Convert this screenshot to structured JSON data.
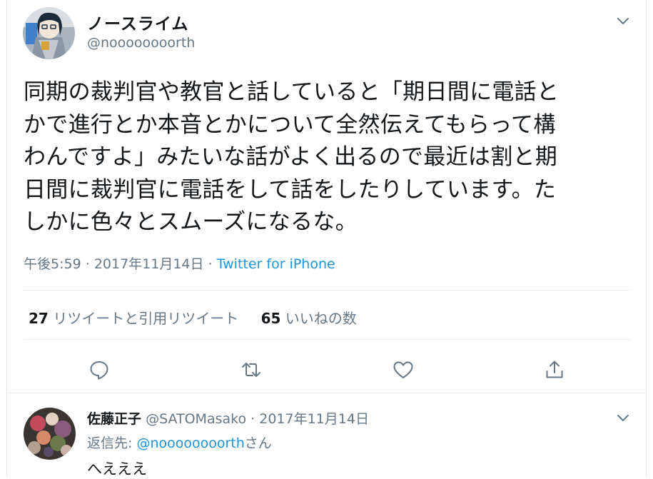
{
  "tweet": {
    "author": {
      "name": "ノースライム",
      "handle": "@noooooooorth"
    },
    "text": "同期の裁判官や教官と話していると「期日間に電話と\nかで進行とか本音とかについて全然伝えてもらって構\nわんですよ」みたいな話がよく出るので最近は割と期\n日間に裁判官に電話をして話をしたりしています。た\nしかに色々とスムーズになるな。",
    "time": "午後5:59",
    "date": "2017年11月14日",
    "separator": "·",
    "source": "Twitter for iPhone",
    "stats": {
      "retweets_count": "27",
      "retweets_label": "リツイートと引用リツイート",
      "likes_count": "65",
      "likes_label": "いいねの数"
    }
  },
  "actions": [
    {
      "name": "reply",
      "icon": "reply-icon"
    },
    {
      "name": "retweet",
      "icon": "retweet-icon"
    },
    {
      "name": "like",
      "icon": "heart-icon"
    },
    {
      "name": "share",
      "icon": "share-icon"
    }
  ],
  "reply": {
    "author": {
      "name": "佐藤正子",
      "handle": "@SATOMasako"
    },
    "separator": "·",
    "date": "2017年11月14日",
    "reply_to_label": "返信先:",
    "reply_to_handle": "@noooooooorth",
    "reply_to_suffix": "さん",
    "text": "へえええ"
  },
  "colors": {
    "link": "#1b95e0",
    "muted": "#657786",
    "text": "#14171a",
    "border": "#e6ecf0"
  }
}
